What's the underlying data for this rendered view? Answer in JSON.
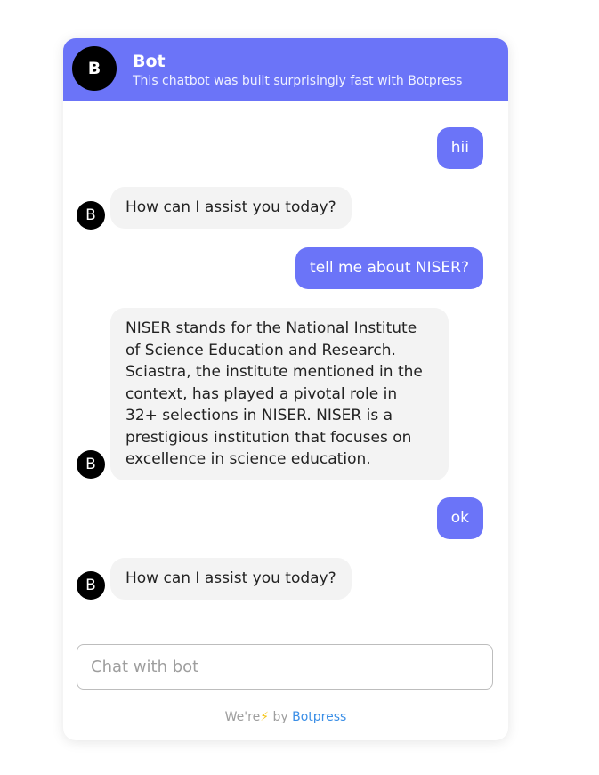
{
  "header": {
    "avatar_letter": "B",
    "title": "Bot",
    "subtitle": "This chatbot was built surprisingly fast with Botpress"
  },
  "bot_avatar_letter": "B",
  "messages": [
    {
      "from": "user",
      "text": "hii"
    },
    {
      "from": "bot",
      "text": "How can I assist you today?"
    },
    {
      "from": "user",
      "text": "tell me about NISER?"
    },
    {
      "from": "bot",
      "text": "NISER stands for the National Institute of Science Education and Research. Sciastra, the institute mentioned in the context, has played a pivotal role in 32+ selections in NISER. NISER is a prestigious institution that focuses on excellence in science education."
    },
    {
      "from": "user",
      "text": "ok"
    },
    {
      "from": "bot",
      "text": "How can I assist you today?"
    }
  ],
  "composer": {
    "placeholder": "Chat with bot",
    "value": ""
  },
  "footer": {
    "prefix": "We're",
    "bolt_icon": "⚡",
    "by": "by",
    "brand": "Botpress"
  },
  "colors": {
    "accent": "#6b74f8",
    "bot_bubble": "#f3f3f3",
    "link": "#3a8ee6",
    "bolt": "#f5c518"
  }
}
